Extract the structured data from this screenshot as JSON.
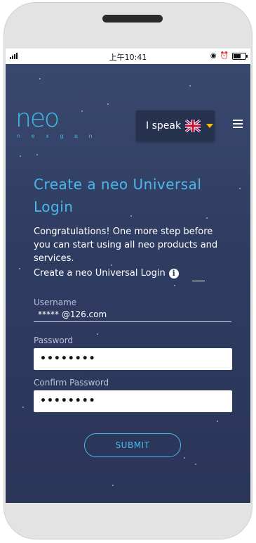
{
  "status": {
    "time": "上午10:41"
  },
  "brand": {
    "logo_text": "neo",
    "tagline": "n e x g e n"
  },
  "language": {
    "label": "I speak"
  },
  "page": {
    "title": "Create a neo Universal Login",
    "intro": "Congratulations! One more step before you can start using all neo products and services.",
    "info_text": "Create a neo Universal Login"
  },
  "form": {
    "username_label": "Username",
    "username_value": "***** @126.com",
    "password_label": "Password",
    "password_value": "••••••••",
    "confirm_label": "Confirm Password",
    "confirm_value": "••••••••",
    "submit_label": "SUBMIT"
  },
  "colors": {
    "accent": "#4ab8ec",
    "background": "#2f3c61",
    "caret": "#f2c200"
  }
}
